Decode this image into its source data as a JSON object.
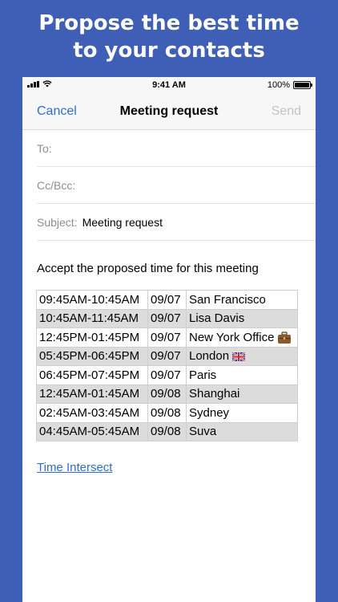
{
  "promo": {
    "line1": "Propose the best time",
    "line2": "to your contacts"
  },
  "status_bar": {
    "time": "9:41 AM",
    "battery": "100%"
  },
  "navbar": {
    "cancel": "Cancel",
    "title": "Meeting request",
    "send": "Send"
  },
  "fields": {
    "to_label": "To:",
    "cc_label": "Cc/Bcc:",
    "subject_label": "Subject:",
    "subject_value": "Meeting request"
  },
  "message": {
    "intro": "Accept the proposed time for this meeting"
  },
  "times": [
    {
      "time": "09:45AM-10:45AM",
      "date": "09/07",
      "city": "San Francisco"
    },
    {
      "time": "10:45AM-11:45AM",
      "date": "09/07",
      "city": "Lisa Davis"
    },
    {
      "time": "12:45PM-01:45PM",
      "date": "09/07",
      "city": "New York Office",
      "icon": "briefcase-icon"
    },
    {
      "time": "05:45PM-06:45PM",
      "date": "09/07",
      "city": "London",
      "icon": "uk-flag-icon"
    },
    {
      "time": "06:45PM-07:45PM",
      "date": "09/07",
      "city": "Paris"
    },
    {
      "time": "12:45AM-01:45AM",
      "date": "09/08",
      "city": "Shanghai"
    },
    {
      "time": "02:45AM-03:45AM",
      "date": "09/08",
      "city": "Sydney"
    },
    {
      "time": "04:45AM-05:45AM",
      "date": "09/08",
      "city": "Suva"
    }
  ],
  "link": {
    "label": "Time Intersect"
  },
  "colors": {
    "background": "#3f5fb7",
    "accent": "#2f6fd0",
    "disabled": "#c4c4c4"
  }
}
